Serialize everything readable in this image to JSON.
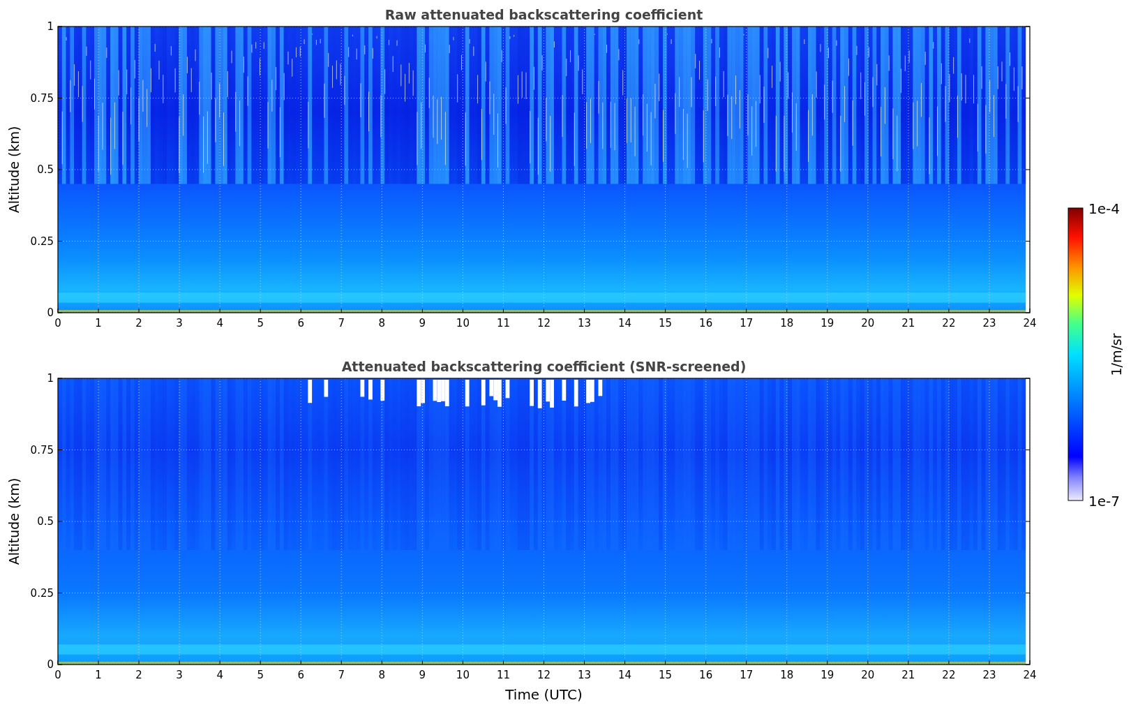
{
  "panels": [
    {
      "kind": "raw",
      "title": "Raw attenuated backscattering coefficient",
      "ylabel": "Altitude (km)",
      "yticks": [
        "1",
        "0.75",
        "0.5",
        "0.25",
        "0"
      ],
      "xticks": [
        "0",
        "1",
        "2",
        "3",
        "4",
        "5",
        "6",
        "7",
        "8",
        "9",
        "10",
        "11",
        "12",
        "13",
        "14",
        "15",
        "16",
        "17",
        "18",
        "19",
        "20",
        "21",
        "22",
        "23",
        "24"
      ]
    },
    {
      "kind": "screened",
      "title": "Attenuated backscattering coefficient (SNR-screened)",
      "ylabel": "Altitude (km)",
      "yticks": [
        "1",
        "0.75",
        "0.5",
        "0.25",
        "0"
      ],
      "xticks": [
        "0",
        "1",
        "2",
        "3",
        "4",
        "5",
        "6",
        "7",
        "8",
        "9",
        "10",
        "11",
        "12",
        "13",
        "14",
        "15",
        "16",
        "17",
        "18",
        "19",
        "20",
        "21",
        "22",
        "23",
        "24"
      ],
      "xlabel": "Time (UTC)"
    }
  ],
  "colorbar": {
    "max_label": "1e-4",
    "min_label": "1e-7",
    "label": "1/m/sr"
  }
}
